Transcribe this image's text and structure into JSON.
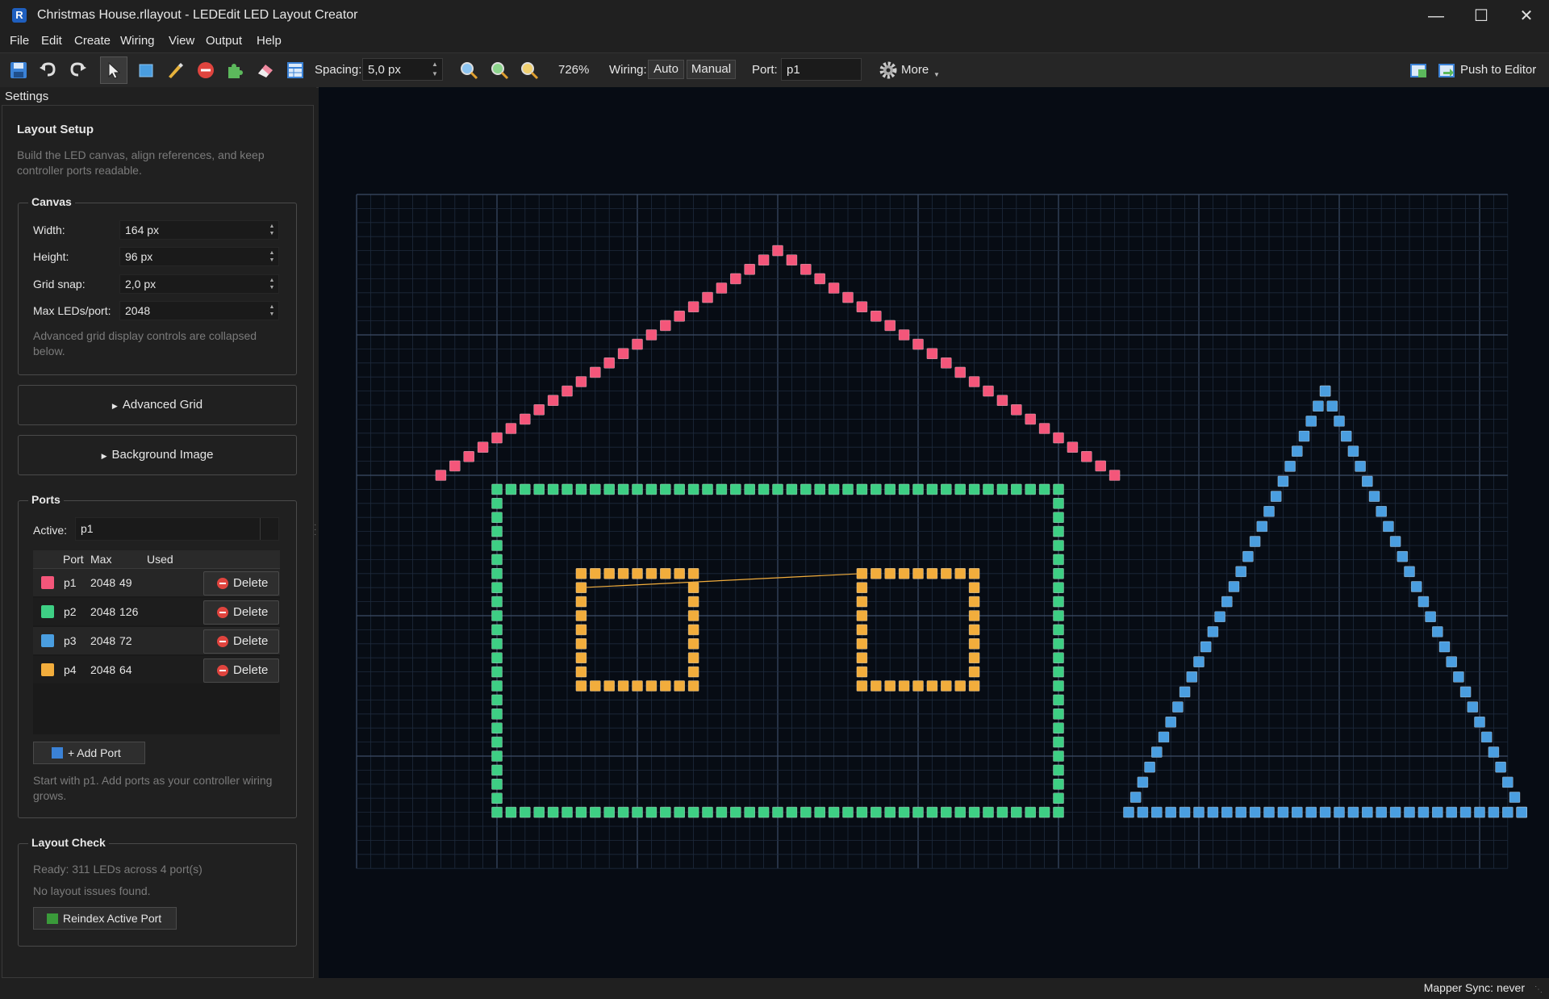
{
  "window": {
    "title": "Christmas House.rllayout - LEDEdit LED Layout Creator",
    "app_icon": "R",
    "controls": [
      "minimize-icon",
      "maximize-icon",
      "close-icon"
    ]
  },
  "menu": [
    "File",
    "Edit",
    "Create",
    "Wiring",
    "View",
    "Output",
    "Help"
  ],
  "toolbar": {
    "icons": [
      "save-icon",
      "undo-icon",
      "redo-icon",
      "select-icon",
      "rectangle-icon",
      "paint-icon",
      "delete-icon",
      "puzzle-icon",
      "eraser-icon",
      "table-icon"
    ],
    "spacing_label": "Spacing:",
    "spacing_value": "5,0 px",
    "zoom_value": "726%",
    "wiring_label": "Wiring:",
    "wiring_auto": "Auto",
    "wiring_manual": "Manual",
    "port_label": "Port:",
    "port_value": "p1",
    "more_label": "More",
    "push_label": "Push to Editor"
  },
  "settings": {
    "panel_title": "Settings",
    "section_title": "Layout Setup",
    "section_desc_1": "Build the LED canvas, align references, and keep",
    "section_desc_2": "controller ports readable.",
    "canvas": {
      "title": "Canvas",
      "width_label": "Width:",
      "width_value": "164 px",
      "height_label": "Height:",
      "height_value": "96 px",
      "snap_label": "Grid snap:",
      "snap_value": "2,0 px",
      "max_label": "Max LEDs/port:",
      "max_value": "2048",
      "note_1": "Advanced grid display controls are collapsed",
      "note_2": "below."
    },
    "advanced_grid": "Advanced Grid",
    "background_image": "Background Image",
    "ports": {
      "title": "Ports",
      "active_label": "Active:",
      "active_value": "p1",
      "headers": [
        "Port",
        "Max",
        "Used"
      ],
      "rows": [
        {
          "port": "p1",
          "max": "2048",
          "used": "49",
          "color": "#f4567a"
        },
        {
          "port": "p2",
          "max": "2048",
          "used": "126",
          "color": "#3ecf84"
        },
        {
          "port": "p3",
          "max": "2048",
          "used": "72",
          "color": "#4a9ee0"
        },
        {
          "port": "p4",
          "max": "2048",
          "used": "64",
          "color": "#f2ad3c"
        }
      ],
      "delete_label": "Delete",
      "add_port": "+ Add Port",
      "hint_1": "Start with p1. Add ports as your controller wiring",
      "hint_2": "grows."
    },
    "layout_check": {
      "title": "Layout Check",
      "status": "Ready: 311 LEDs across 4 port(s)",
      "issues": "No layout issues found.",
      "reindex": "Reindex Active Port"
    }
  },
  "canvas": {
    "grid_cols": 82,
    "grid_rows": 48,
    "port_colors": {
      "p1": "#f4567a",
      "p2": "#3ecf84",
      "p3": "#4a9ee0",
      "p4": "#f2ad3c"
    }
  },
  "status": {
    "mapper_sync": "Mapper Sync: never"
  }
}
